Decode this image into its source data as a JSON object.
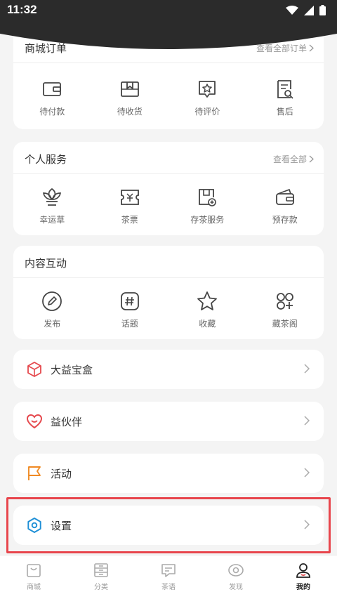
{
  "status_bar": {
    "time": "11:32"
  },
  "mall_orders": {
    "title": "商城订单",
    "more": "查看全部订单",
    "items": [
      {
        "label": "待付款",
        "icon": "wallet-icon"
      },
      {
        "label": "待收货",
        "icon": "package-icon"
      },
      {
        "label": "待评价",
        "icon": "star-chat-icon"
      },
      {
        "label": "售后",
        "icon": "doc-search-icon"
      }
    ]
  },
  "personal_services": {
    "title": "个人服务",
    "more": "查看全部",
    "items": [
      {
        "label": "幸运草",
        "icon": "plant-icon"
      },
      {
        "label": "茶票",
        "icon": "ticket-icon"
      },
      {
        "label": "存茶服务",
        "icon": "tea-storage-icon"
      },
      {
        "label": "预存款",
        "icon": "purse-icon"
      }
    ]
  },
  "content_interaction": {
    "title": "内容互动",
    "items": [
      {
        "label": "发布",
        "icon": "pencil-icon"
      },
      {
        "label": "话题",
        "icon": "hashtag-icon"
      },
      {
        "label": "收藏",
        "icon": "star-icon"
      },
      {
        "label": "藏茶阁",
        "icon": "grid-plus-icon"
      }
    ]
  },
  "menu_rows": [
    {
      "label": "大益宝盒",
      "icon": "box-icon",
      "color": "#e5484d"
    },
    {
      "label": "益伙伴",
      "icon": "heart-icon",
      "color": "#e5484d"
    },
    {
      "label": "活动",
      "icon": "flag-icon",
      "color": "#f08a24"
    },
    {
      "label": "设置",
      "icon": "settings-icon",
      "color": "#1e8fd6"
    }
  ],
  "tabbar": {
    "items": [
      {
        "label": "商城",
        "icon": "shop-icon"
      },
      {
        "label": "分类",
        "icon": "category-icon"
      },
      {
        "label": "茶语",
        "icon": "chat-icon"
      },
      {
        "label": "发现",
        "icon": "discover-icon"
      },
      {
        "label": "我的",
        "icon": "profile-icon"
      }
    ],
    "active": "我的"
  },
  "colors": {
    "accent_red": "#e5484d",
    "status_bar": "#2b2b2b",
    "highlight": "#e8454c"
  }
}
